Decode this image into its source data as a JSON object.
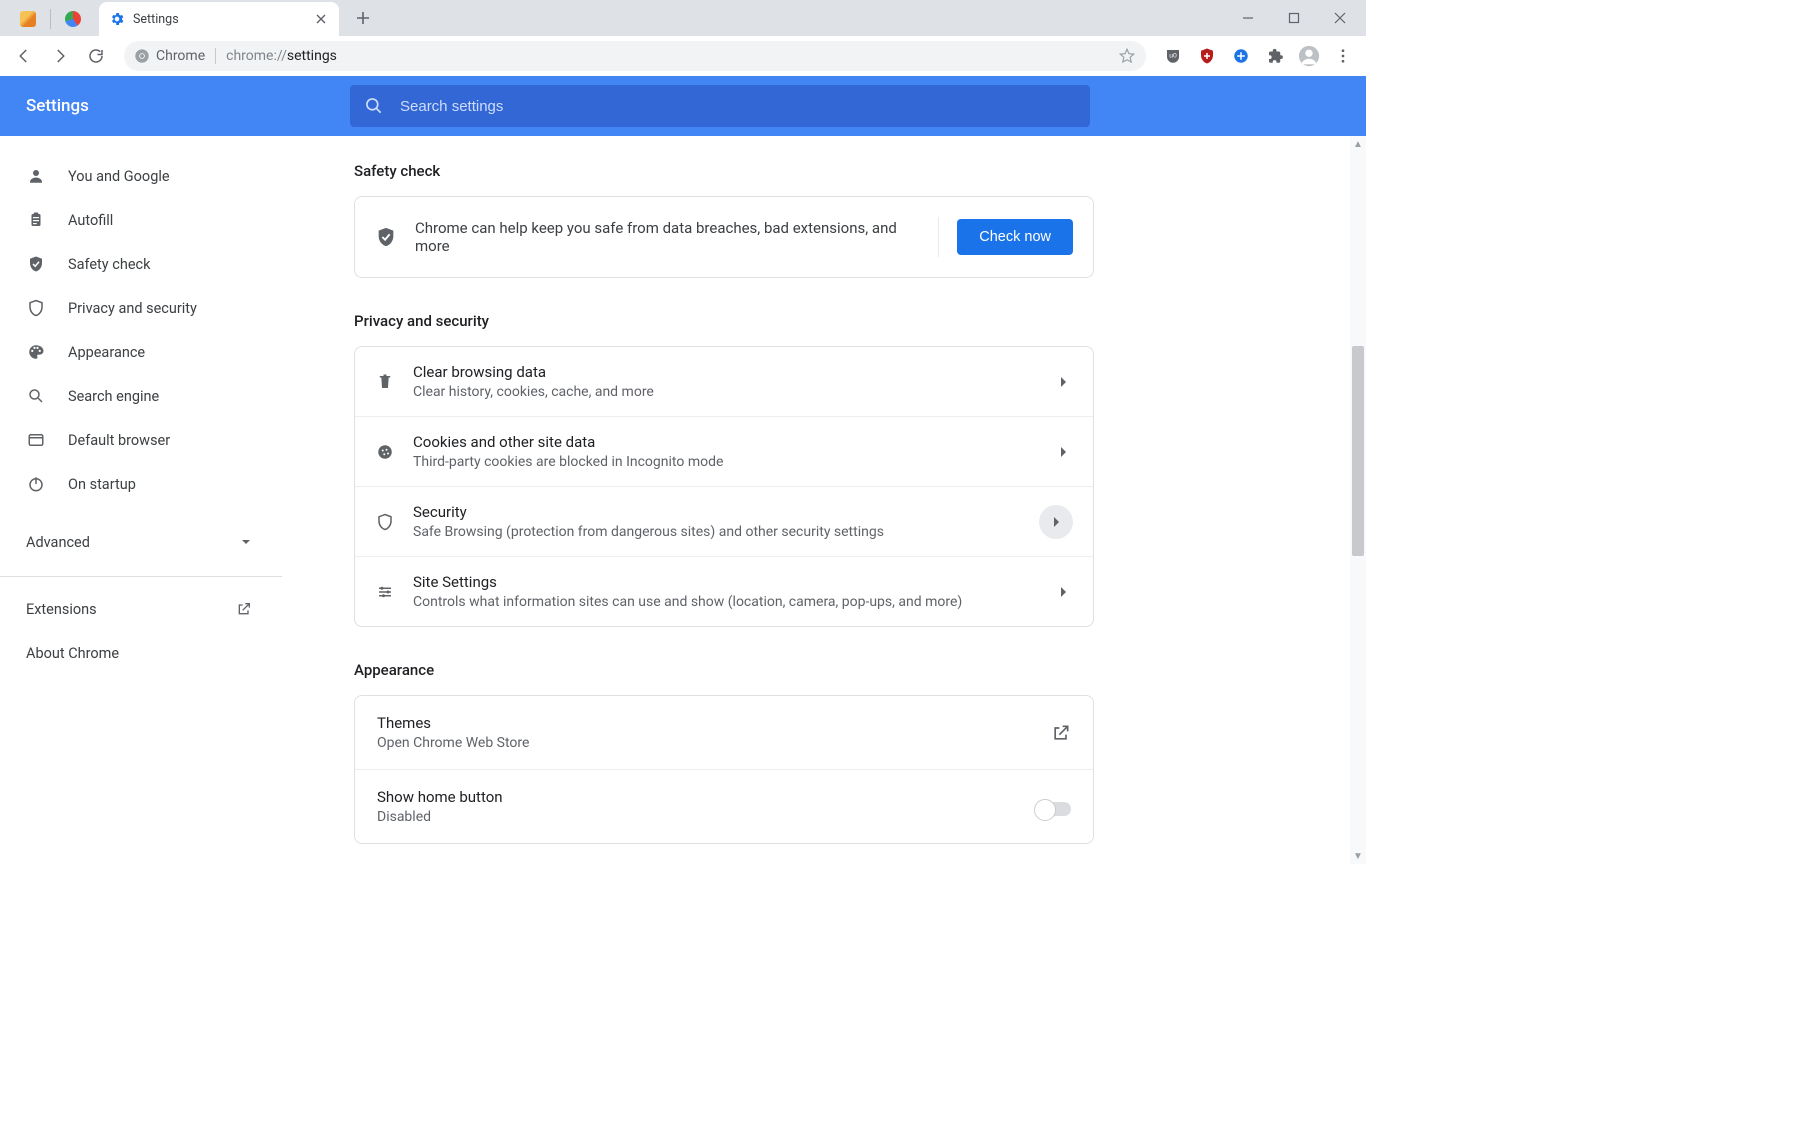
{
  "tab": {
    "title": "Settings"
  },
  "omnibox": {
    "chip": "Chrome",
    "url_grey": "chrome://",
    "url_dark": "settings"
  },
  "header": {
    "title": "Settings"
  },
  "search": {
    "placeholder": "Search settings"
  },
  "sidebar": {
    "items": [
      {
        "label": "You and Google",
        "icon": "person"
      },
      {
        "label": "Autofill",
        "icon": "clipboard"
      },
      {
        "label": "Safety check",
        "icon": "shield-check"
      },
      {
        "label": "Privacy and security",
        "icon": "shield"
      },
      {
        "label": "Appearance",
        "icon": "palette"
      },
      {
        "label": "Search engine",
        "icon": "search"
      },
      {
        "label": "Default browser",
        "icon": "browser"
      },
      {
        "label": "On startup",
        "icon": "power"
      }
    ],
    "advanced": "Advanced",
    "extensions": "Extensions",
    "about": "About Chrome"
  },
  "safety": {
    "section": "Safety check",
    "text": "Chrome can help keep you safe from data breaches, bad extensions, and more",
    "button": "Check now"
  },
  "privacy": {
    "section": "Privacy and security",
    "rows": [
      {
        "title": "Clear browsing data",
        "sub": "Clear history, cookies, cache, and more",
        "icon": "trash"
      },
      {
        "title": "Cookies and other site data",
        "sub": "Third-party cookies are blocked in Incognito mode",
        "icon": "cookie"
      },
      {
        "title": "Security",
        "sub": "Safe Browsing (protection from dangerous sites) and other security settings",
        "icon": "shield",
        "hover": true
      },
      {
        "title": "Site Settings",
        "sub": "Controls what information sites can use and show (location, camera, pop-ups, and more)",
        "icon": "tune"
      }
    ]
  },
  "appearance": {
    "section": "Appearance",
    "themes": {
      "title": "Themes",
      "sub": "Open Chrome Web Store"
    },
    "home": {
      "title": "Show home button",
      "sub": "Disabled"
    }
  }
}
